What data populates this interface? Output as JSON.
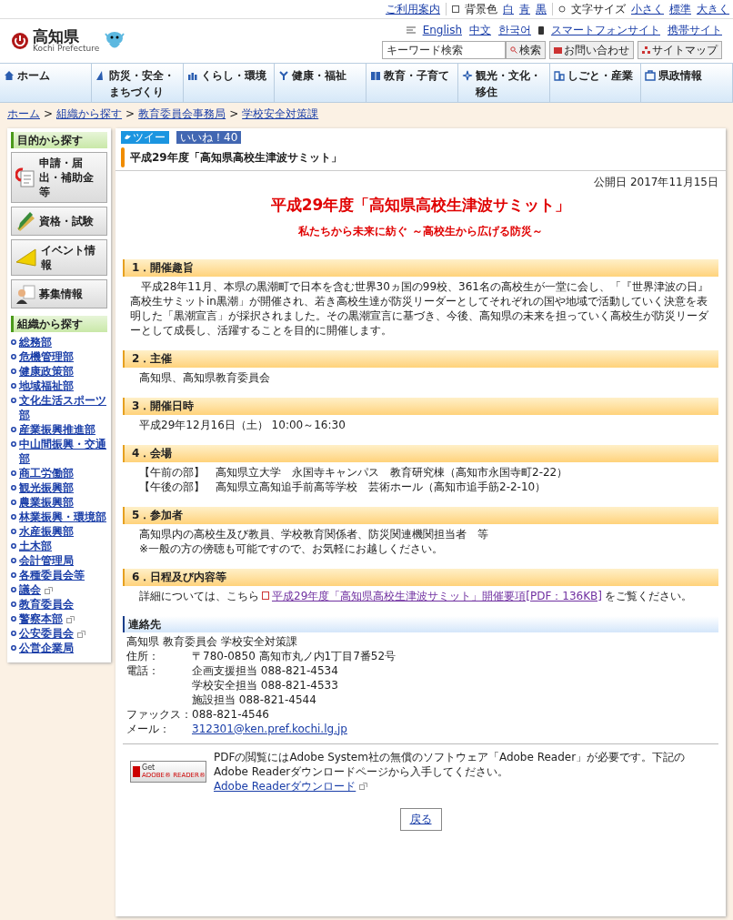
{
  "utility_bar": {
    "guide": "ご利用案内",
    "bg_label": "背景色",
    "bg_options": [
      "白",
      "青",
      "黒"
    ],
    "font_label": "文字サイズ",
    "font_options": [
      "小さく",
      "標準",
      "大きく"
    ]
  },
  "header": {
    "logo_text": "高知県",
    "logo_sub": "Kochi Prefecture",
    "languages": [
      "English",
      "中文",
      "한국어"
    ],
    "smartphone": "スマートフォンサイト",
    "mobile": "携帯サイト",
    "search_placeholder": "キーワード検索",
    "search_button": "検索",
    "contact_button": "お問い合わせ",
    "sitemap_button": "サイトマップ"
  },
  "nav": [
    "ホーム",
    "防災・安全・まちづくり",
    "くらし・環境",
    "健康・福祉",
    "教育・子育て",
    "観光・文化・移住",
    "しごと・産業",
    "県政情報"
  ],
  "breadcrumb": {
    "separator": ">",
    "items": [
      "ホーム",
      "組織から探す",
      "教育委員会事務局",
      "学校安全対策課"
    ]
  },
  "sidebar": {
    "purpose_heading": "目的から探す",
    "purpose_buttons": [
      "申請・届出・補助金等",
      "資格・試験",
      "イベント情報",
      "募集情報"
    ],
    "org_heading": "組織から探す",
    "org_links": [
      {
        "label": "総務部",
        "external": false
      },
      {
        "label": "危機管理部",
        "external": false
      },
      {
        "label": "健康政策部",
        "external": false
      },
      {
        "label": "地域福祉部",
        "external": false
      },
      {
        "label": "文化生活スポーツ部",
        "external": false
      },
      {
        "label": "産業振興推進部",
        "external": false
      },
      {
        "label": "中山間振興・交通部",
        "external": false
      },
      {
        "label": "商工労働部",
        "external": false
      },
      {
        "label": "観光振興部",
        "external": false
      },
      {
        "label": "農業振興部",
        "external": false
      },
      {
        "label": "林業振興・環境部",
        "external": false
      },
      {
        "label": "水産振興部",
        "external": false
      },
      {
        "label": "土木部",
        "external": false
      },
      {
        "label": "会計管理局",
        "external": false
      },
      {
        "label": "各種委員会等",
        "external": false
      },
      {
        "label": "議会",
        "external": true
      },
      {
        "label": "教育委員会",
        "external": false
      },
      {
        "label": "警察本部",
        "external": true
      },
      {
        "label": "公安委員会",
        "external": true
      },
      {
        "label": "公営企業局",
        "external": false
      }
    ]
  },
  "social": {
    "tweet": "ツイー",
    "like": "いいね！40"
  },
  "page_title": "平成29年度「高知県高校生津波サミット」",
  "published": "公開日 2017年11月15日",
  "title": "平成29年度「高知県高校生津波サミット」",
  "subtitle": "私たちから未来に紡ぐ ～高校生から広げる防災～",
  "sections": [
    {
      "heading": "1．開催趣旨",
      "kind": "text",
      "indent": true,
      "lines": [
        "平成28年11月、本県の黒潮町で日本を含む世界30ヵ国の99校、361名の高校生が一堂に会し、「『世界津波の日』高校生サミットin黒潮」が開催され、若き高校生達が防災リーダーとしてそれぞれの国や地域で活動していく決意を表明した「黒潮宣言」が採択されました。その黒潮宣言に基づき、今後、高知県の未来を担っていく高校生が防災リーダーとして成長し、活躍することを目的に開催します。"
      ]
    },
    {
      "heading": "2．主催",
      "kind": "text",
      "indent": false,
      "lines": [
        "高知県、高知県教育委員会"
      ]
    },
    {
      "heading": "3．開催日時",
      "kind": "text",
      "indent": false,
      "lines": [
        "平成29年12月16日（土） 10:00～16:30"
      ]
    },
    {
      "heading": "4．会場",
      "kind": "text",
      "indent": false,
      "lines": [
        "【午前の部】　高知県立大学　永国寺キャンパス　教育研究棟（高知市永国寺町2-22）",
        "【午後の部】　高知県立高知追手前高等学校　芸術ホール（高知市追手筋2-2-10）"
      ]
    },
    {
      "heading": "5．参加者",
      "kind": "text",
      "indent": false,
      "lines": [
        "高知県内の高校生及び教員、学校教育関係者、防災関連機関担当者　等",
        "※一般の方の傍聴も可能ですので、お気軽にお越しください。"
      ]
    },
    {
      "heading": "6．日程及び内容等",
      "kind": "link",
      "before": "詳細については、こちら",
      "link": "平成29年度「高知県高校生津波サミット」開催要項[PDF：136KB]",
      "after": "をご覧ください。"
    }
  ],
  "contact": {
    "heading": "連絡先",
    "org": "高知県 教育委員会 学校安全対策課",
    "rows": [
      {
        "label": "住所：",
        "values": [
          "〒780-0850 高知市丸ノ内1丁目7番52号"
        ],
        "kind": "text"
      },
      {
        "label": "電話：",
        "values": [
          "企画支援担当 088-821-4534",
          "学校安全担当 088-821-4533",
          "施設担当 088-821-4544"
        ],
        "kind": "text"
      },
      {
        "label": "ファックス：",
        "values": [
          "088-821-4546"
        ],
        "kind": "text"
      },
      {
        "label": "メール：",
        "values": [
          "312301@ken.pref.kochi.lg.jp"
        ],
        "kind": "link"
      }
    ]
  },
  "adobe": {
    "badge_small": "Get",
    "badge_text": "ADOBE® READER®",
    "note": "PDFの閲覧にはAdobe System社の無償のソフトウェア「Adobe Reader」が必要です。下記のAdobe Readerダウンロードページから入手してください。",
    "link": "Adobe Readerダウンロード"
  },
  "back_button": "戻る"
}
